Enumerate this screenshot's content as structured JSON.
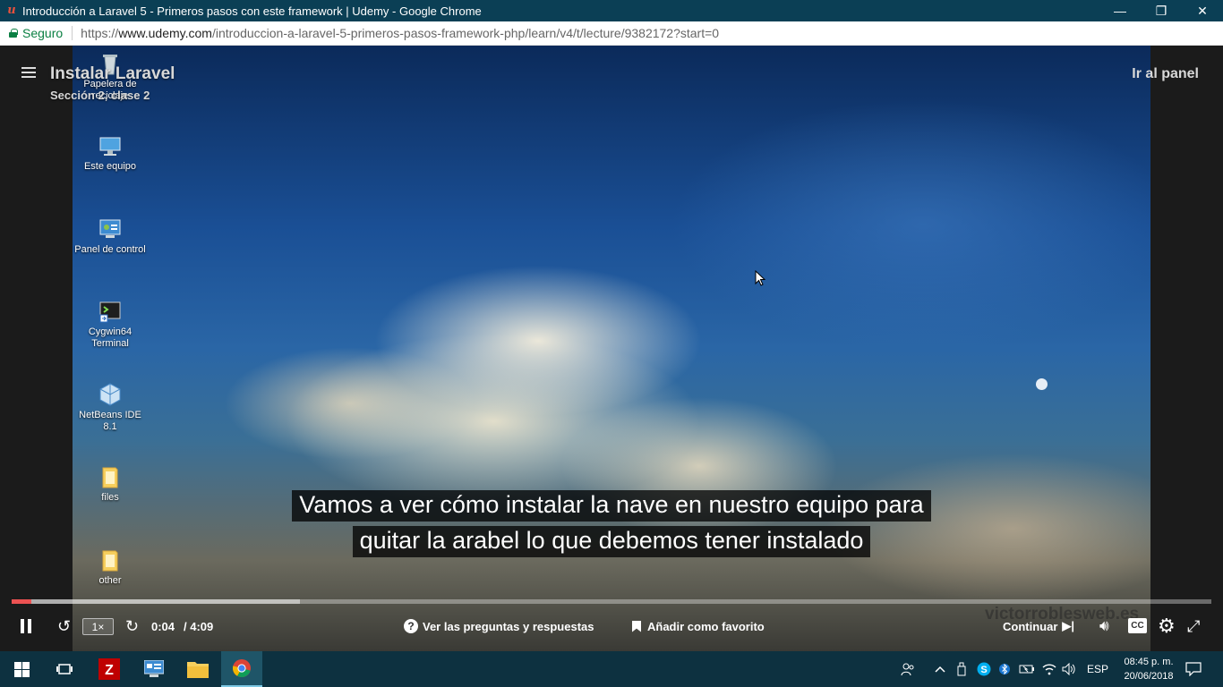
{
  "window": {
    "title": "Introducción a Laravel 5 - Primeros pasos con este framework | Udemy - Google Chrome",
    "minimize": "—",
    "restore": "❐",
    "close": "✕"
  },
  "addressbar": {
    "secure_label": "Seguro",
    "url_proto": "https://",
    "url_domain": "www.udemy.com",
    "url_path": "/introduccion-a-laravel-5-primeros-pasos-framework-php/learn/v4/t/lecture/9382172?start=0"
  },
  "lecture": {
    "title": "Instalar Laravel",
    "subtitle": "Sección 2, clase 2",
    "panel_link": "Ir al panel"
  },
  "desktop_icons": [
    {
      "label": "Papelera de reciclaje",
      "icon": "recycle-bin-icon"
    },
    {
      "label": "Este equipo",
      "icon": "computer-icon"
    },
    {
      "label": "Panel de control",
      "icon": "control-panel-icon"
    },
    {
      "label": "Cygwin64 Terminal",
      "icon": "terminal-icon"
    },
    {
      "label": "NetBeans IDE 8.1",
      "icon": "netbeans-icon"
    },
    {
      "label": "files",
      "icon": "folder-icon"
    },
    {
      "label": "other",
      "icon": "folder-icon"
    }
  ],
  "captions": {
    "line1": "Vamos a ver cómo instalar la nave en nuestro equipo para",
    "line2": "quitar la arabel lo que debemos tener instalado"
  },
  "watermark": "victorroblesweb.es",
  "player": {
    "progress_fraction": 0.0163,
    "buffered_fraction": 0.24,
    "speed": "1×",
    "time_current": "0:04",
    "time_duration": "/ 4:09",
    "qa_label": "Ver las preguntas y respuestas",
    "favorite_label": "Añadir como favorito",
    "continue_label": "Continuar",
    "cc_label": "CC",
    "accent_color": "#ec5252"
  },
  "taskbar": {
    "language": "ESP",
    "time": "08:45 p. m.",
    "date": "20/06/2018"
  }
}
